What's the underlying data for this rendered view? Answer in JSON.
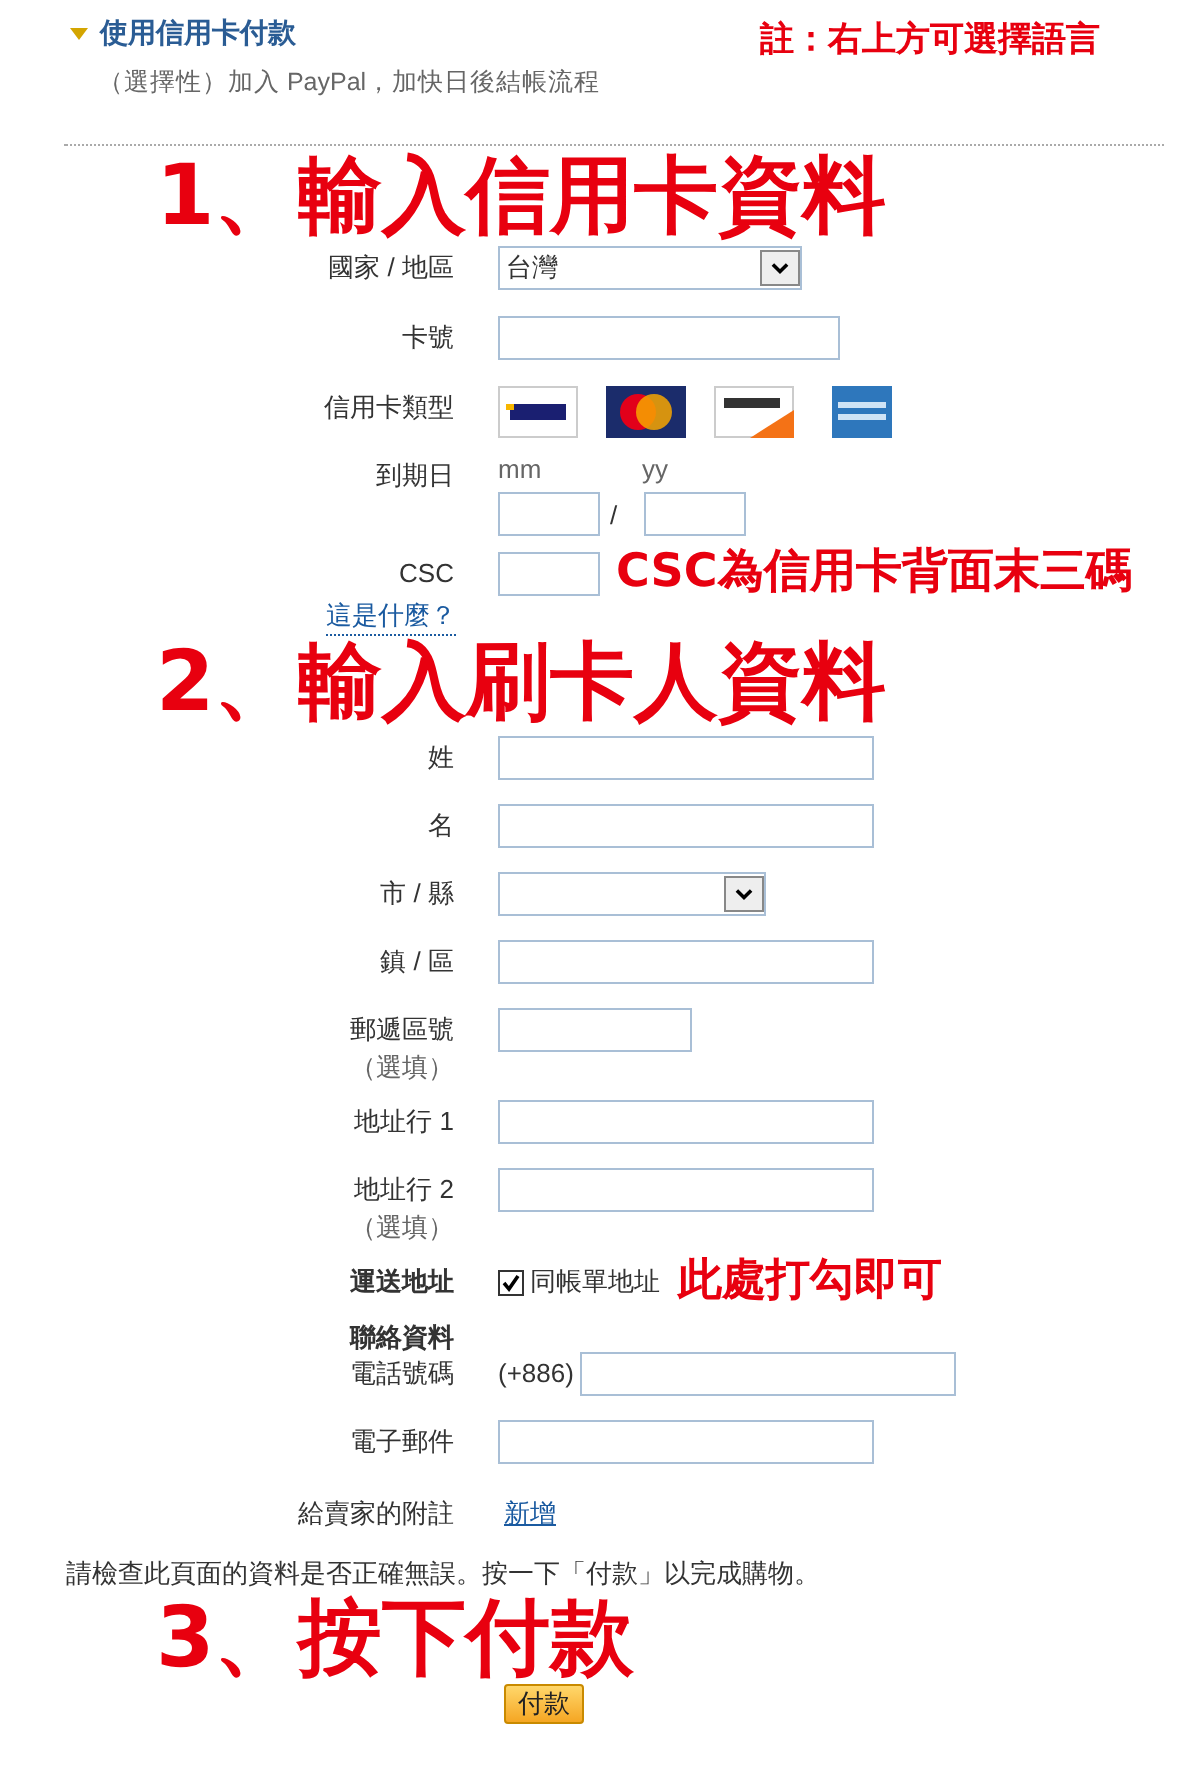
{
  "header": {
    "title": "使用信用卡付款",
    "subtitle": "（選擇性）加入 PayPal，加快日後結帳流程"
  },
  "note": "註：右上方可選擇語言",
  "card_section": {
    "country": {
      "label": "國家 / 地區",
      "value": "台灣"
    },
    "card_number": {
      "label": "卡號"
    },
    "card_type": {
      "label": "信用卡類型"
    },
    "expiry": {
      "label": "到期日",
      "month_label": "mm",
      "year_label": "yy",
      "separator": "/"
    },
    "csc": {
      "label": "CSC",
      "help_link": "這是什麼？"
    }
  },
  "billing": [
    {
      "kind": "text",
      "label": "姓"
    },
    {
      "kind": "text",
      "label": "名"
    },
    {
      "kind": "select",
      "label": "市 / 縣"
    },
    {
      "kind": "text",
      "label": "鎮 / 區"
    },
    {
      "kind": "short",
      "label": "郵遞區號",
      "optional_note": "（選填）"
    },
    {
      "kind": "text",
      "label": "地址行 1"
    },
    {
      "kind": "text",
      "label": "地址行 2",
      "optional_note": "（選填）"
    }
  ],
  "shipping": {
    "label": "運送地址",
    "checkbox_label": "同帳單地址",
    "checked": true
  },
  "contact": {
    "heading": "聯絡資料",
    "phone": {
      "label": "電話號碼",
      "prefix": "(+886)"
    },
    "email": {
      "label": "電子郵件"
    }
  },
  "seller_note": {
    "label": "給賣家的附註",
    "link": "新增"
  },
  "confirmation": "請檢查此頁面的資料是否正確無誤。按一下「付款」以完成購物。",
  "pay_button": "付款",
  "annotations": [
    "1、輸入信用卡資料",
    "CSC為信用卡背面末三碼",
    "2、輸入刷卡人資料",
    "此處打勾即可",
    "3、按下付款"
  ]
}
